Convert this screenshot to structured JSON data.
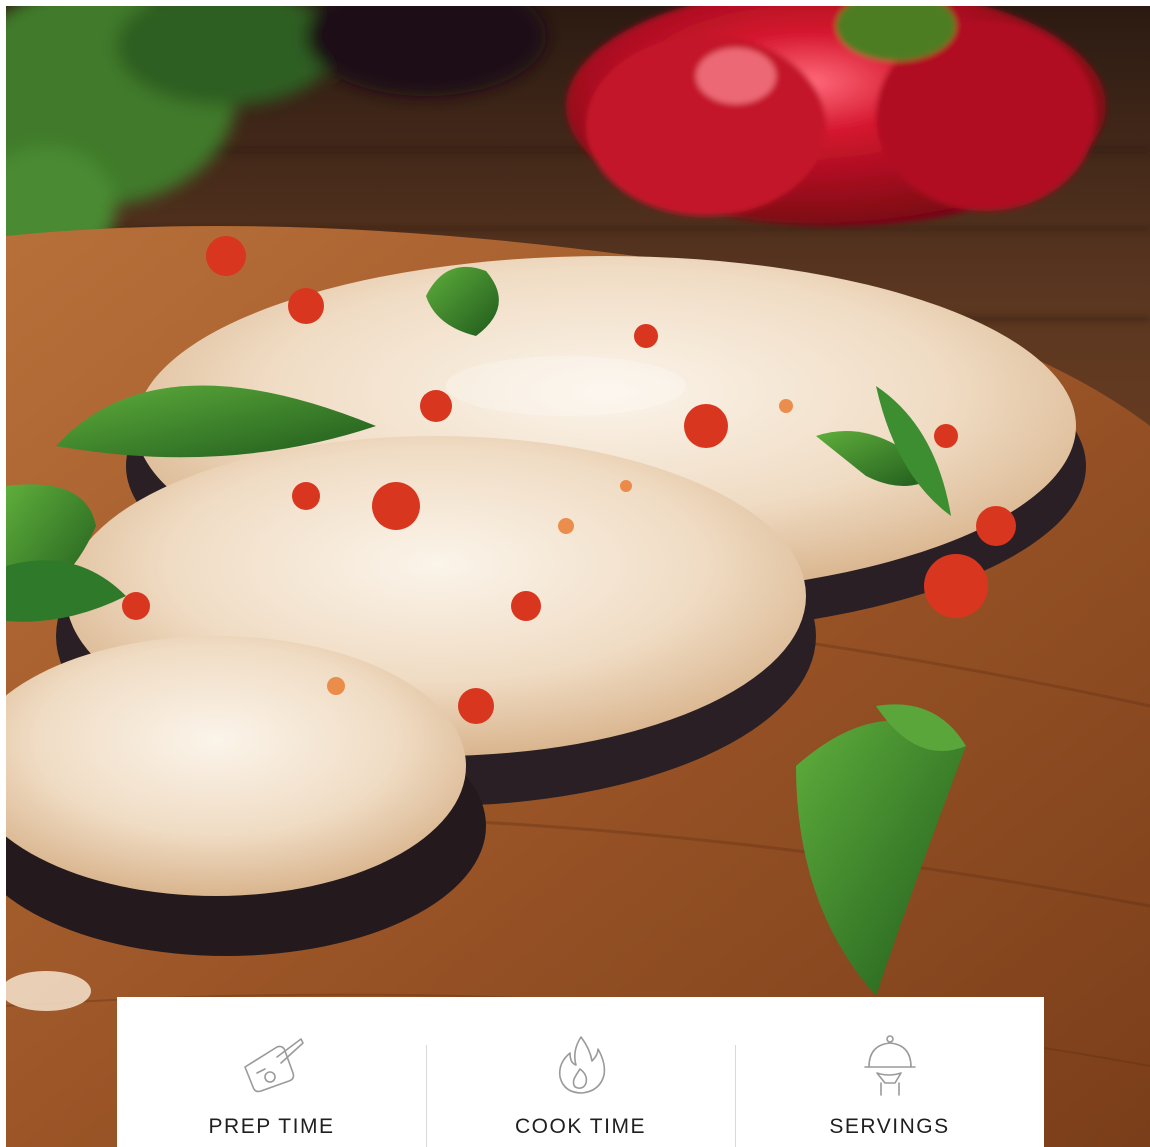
{
  "hero": {
    "image_icon": "eggplant-parmesan-photo",
    "colors": {
      "wood": "#8a4a22",
      "wood_dark": "#3a1f10",
      "cheese": "#f2e6d6",
      "sauce": "#d9361f",
      "basil": "#2f7a2a",
      "pepper": "#c8102e",
      "eggplant": "#2a1f24"
    }
  },
  "info_card": {
    "items": [
      {
        "icon": "cutting-board-knife-icon",
        "label": "PREP TIME"
      },
      {
        "icon": "flame-icon",
        "label": "COOK TIME"
      },
      {
        "icon": "serving-cloche-icon",
        "label": "SERVINGS"
      }
    ]
  }
}
